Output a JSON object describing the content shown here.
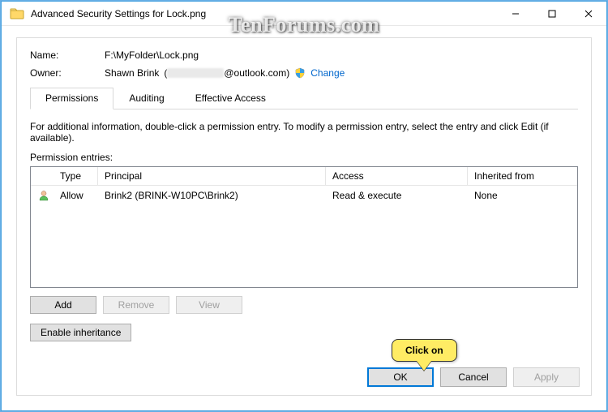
{
  "window": {
    "title": "Advanced Security Settings for Lock.png"
  },
  "watermark": "TenForums.com",
  "fields": {
    "name_label": "Name:",
    "name_value": "F:\\MyFolder\\Lock.png",
    "owner_label": "Owner:",
    "owner_value_prefix": "Shawn Brink",
    "owner_value_suffix": "@outlook.com)",
    "owner_change": "Change"
  },
  "tabs": [
    {
      "label": "Permissions",
      "active": true
    },
    {
      "label": "Auditing",
      "active": false
    },
    {
      "label": "Effective Access",
      "active": false
    }
  ],
  "info_text": "For additional information, double-click a permission entry. To modify a permission entry, select the entry and click Edit (if available).",
  "perm_label": "Permission entries:",
  "columns": {
    "type": "Type",
    "principal": "Principal",
    "access": "Access",
    "inherited": "Inherited from"
  },
  "entries": [
    {
      "type": "Allow",
      "principal": "Brink2 (BRINK-W10PC\\Brink2)",
      "access": "Read & execute",
      "inherited": "None"
    }
  ],
  "buttons": {
    "add": "Add",
    "remove": "Remove",
    "view": "View",
    "enable_inh": "Enable inheritance",
    "ok": "OK",
    "cancel": "Cancel",
    "apply": "Apply"
  },
  "callout": "Click on"
}
